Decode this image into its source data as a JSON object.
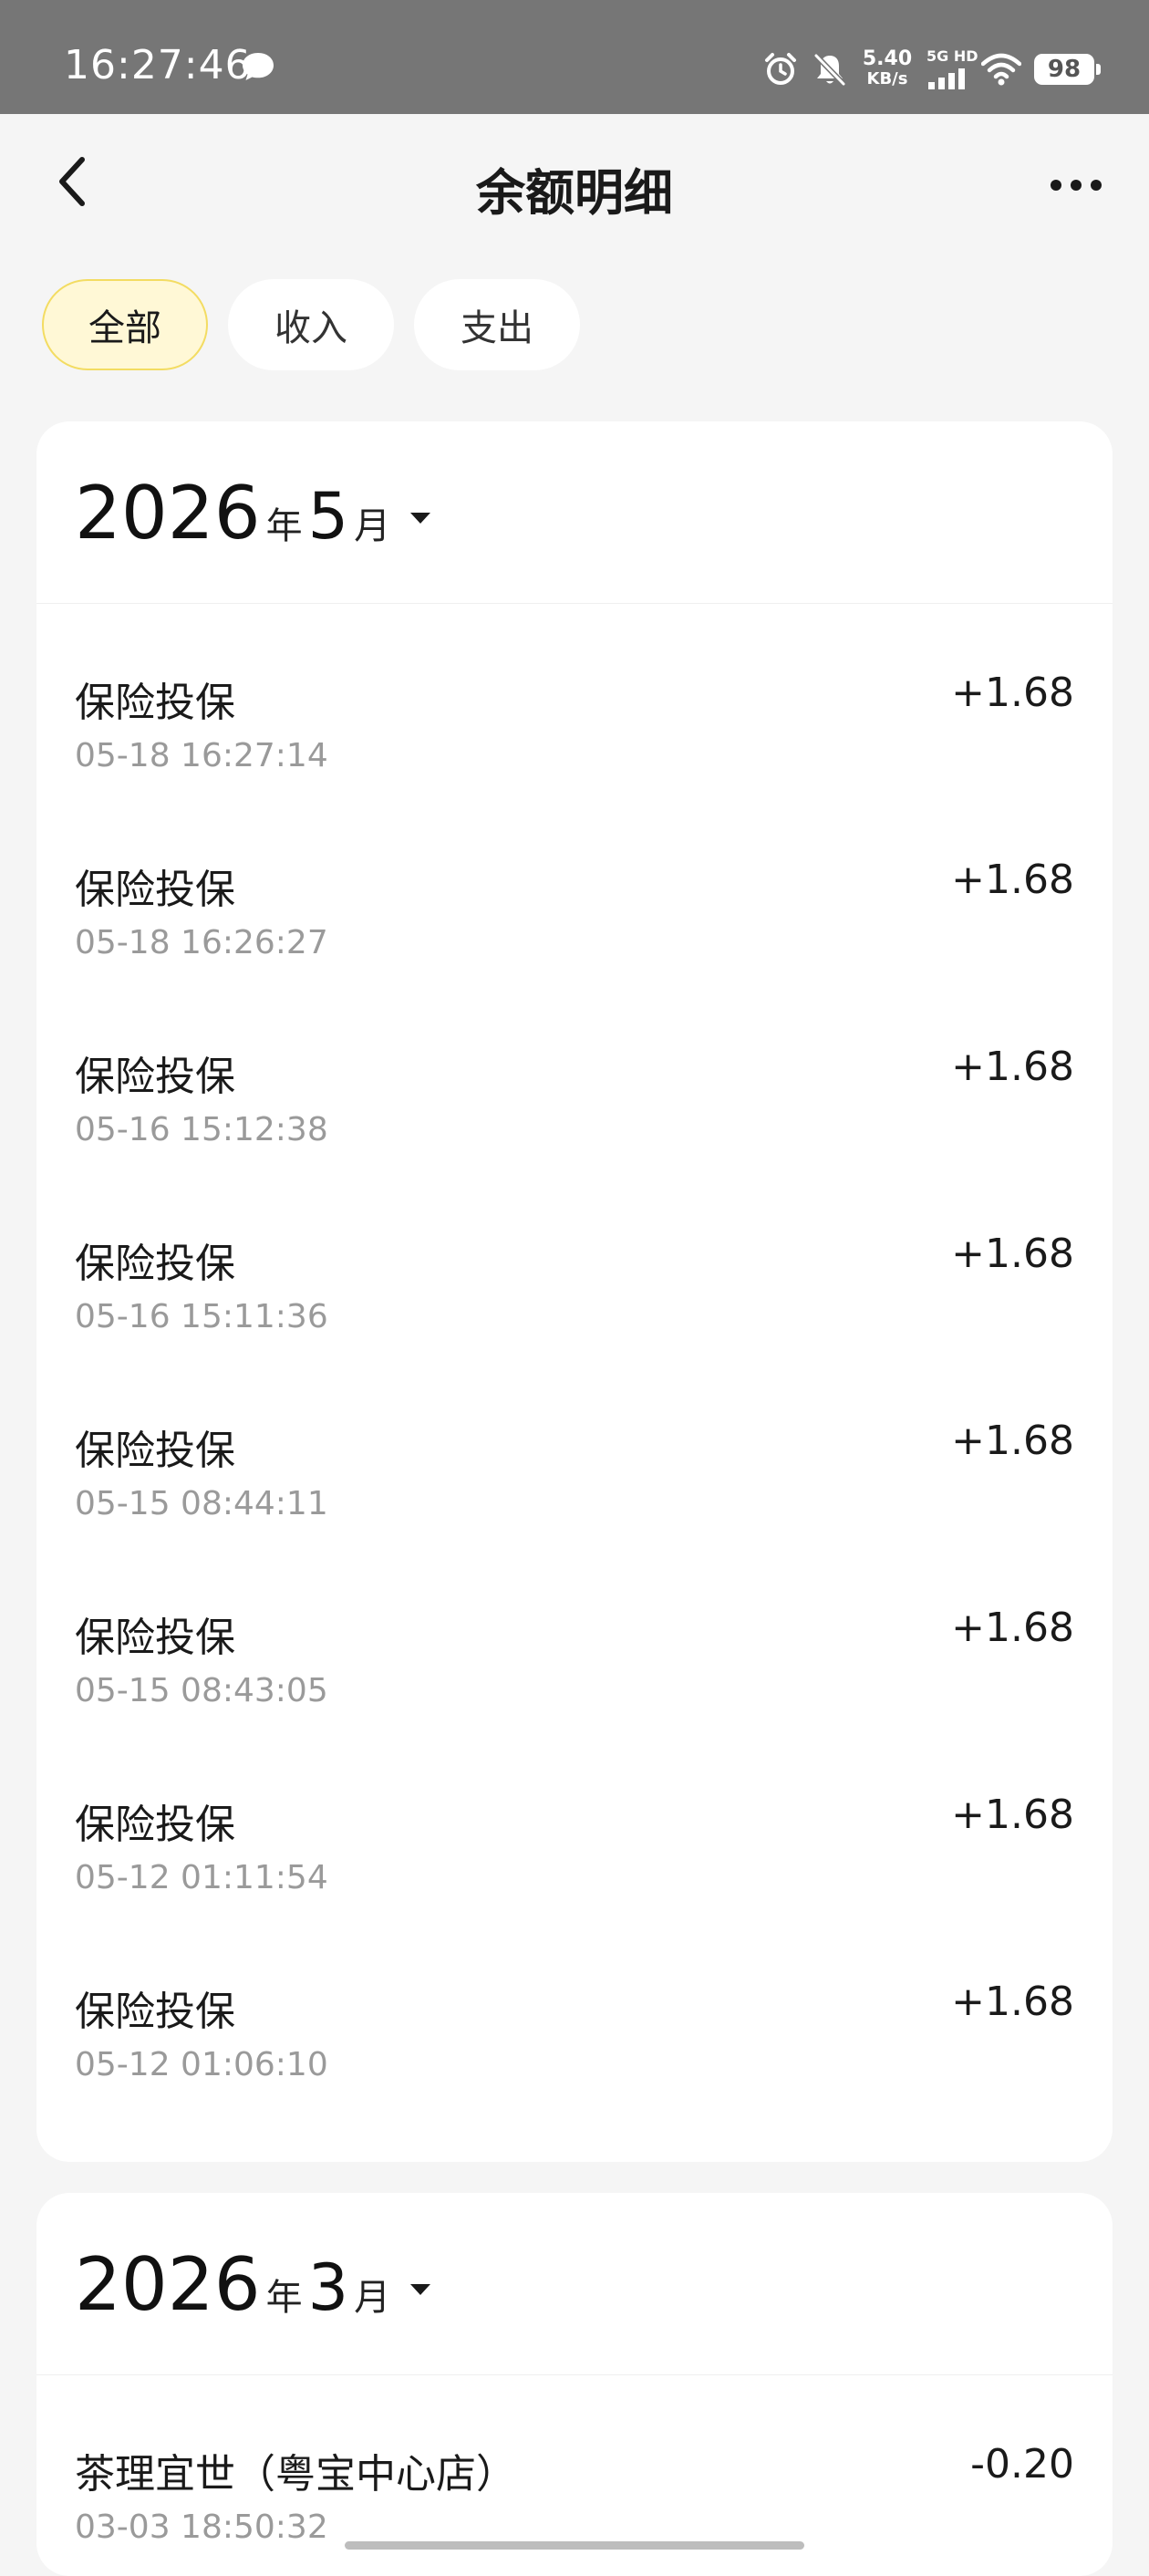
{
  "status_bar": {
    "time": "16:27:46",
    "net_speed_value": "5.40",
    "net_speed_unit": "KB/s",
    "signal_label": "5G HD",
    "battery": "98"
  },
  "nav": {
    "title": "余额明细"
  },
  "filters": [
    {
      "label": "全部",
      "active": true
    },
    {
      "label": "收入",
      "active": false
    },
    {
      "label": "支出",
      "active": false
    }
  ],
  "months": [
    {
      "year": "2026",
      "year_suffix": "年",
      "month": "5",
      "month_suffix": "月",
      "transactions": [
        {
          "title": "保险投保",
          "time": "05-18 16:27:14",
          "amount": "+1.68"
        },
        {
          "title": "保险投保",
          "time": "05-18 16:26:27",
          "amount": "+1.68"
        },
        {
          "title": "保险投保",
          "time": "05-16 15:12:38",
          "amount": "+1.68"
        },
        {
          "title": "保险投保",
          "time": "05-16 15:11:36",
          "amount": "+1.68"
        },
        {
          "title": "保险投保",
          "time": "05-15 08:44:11",
          "amount": "+1.68"
        },
        {
          "title": "保险投保",
          "time": "05-15 08:43:05",
          "amount": "+1.68"
        },
        {
          "title": "保险投保",
          "time": "05-12 01:11:54",
          "amount": "+1.68"
        },
        {
          "title": "保险投保",
          "time": "05-12 01:06:10",
          "amount": "+1.68"
        }
      ]
    },
    {
      "year": "2026",
      "year_suffix": "年",
      "month": "3",
      "month_suffix": "月",
      "transactions": [
        {
          "title": "茶理宜世（粤宝中心店）",
          "time": "03-03 18:50:32",
          "amount": "-0.20"
        }
      ]
    }
  ],
  "colors": {
    "status_bar_bg": "#767676",
    "page_bg": "#f5f5f5",
    "active_chip_bg": "#fff8d6",
    "active_chip_border": "#f3dc62",
    "secondary_text": "#9a9a9a"
  },
  "icons": {
    "back": "chevron-left-icon",
    "more": "more-dots-icon",
    "month_caret": "caret-down-icon",
    "message": "chat-bubble-icon",
    "alarm": "alarm-icon",
    "mute": "bell-off-icon",
    "wifi": "wifi-icon",
    "signal": "signal-bars-icon"
  }
}
